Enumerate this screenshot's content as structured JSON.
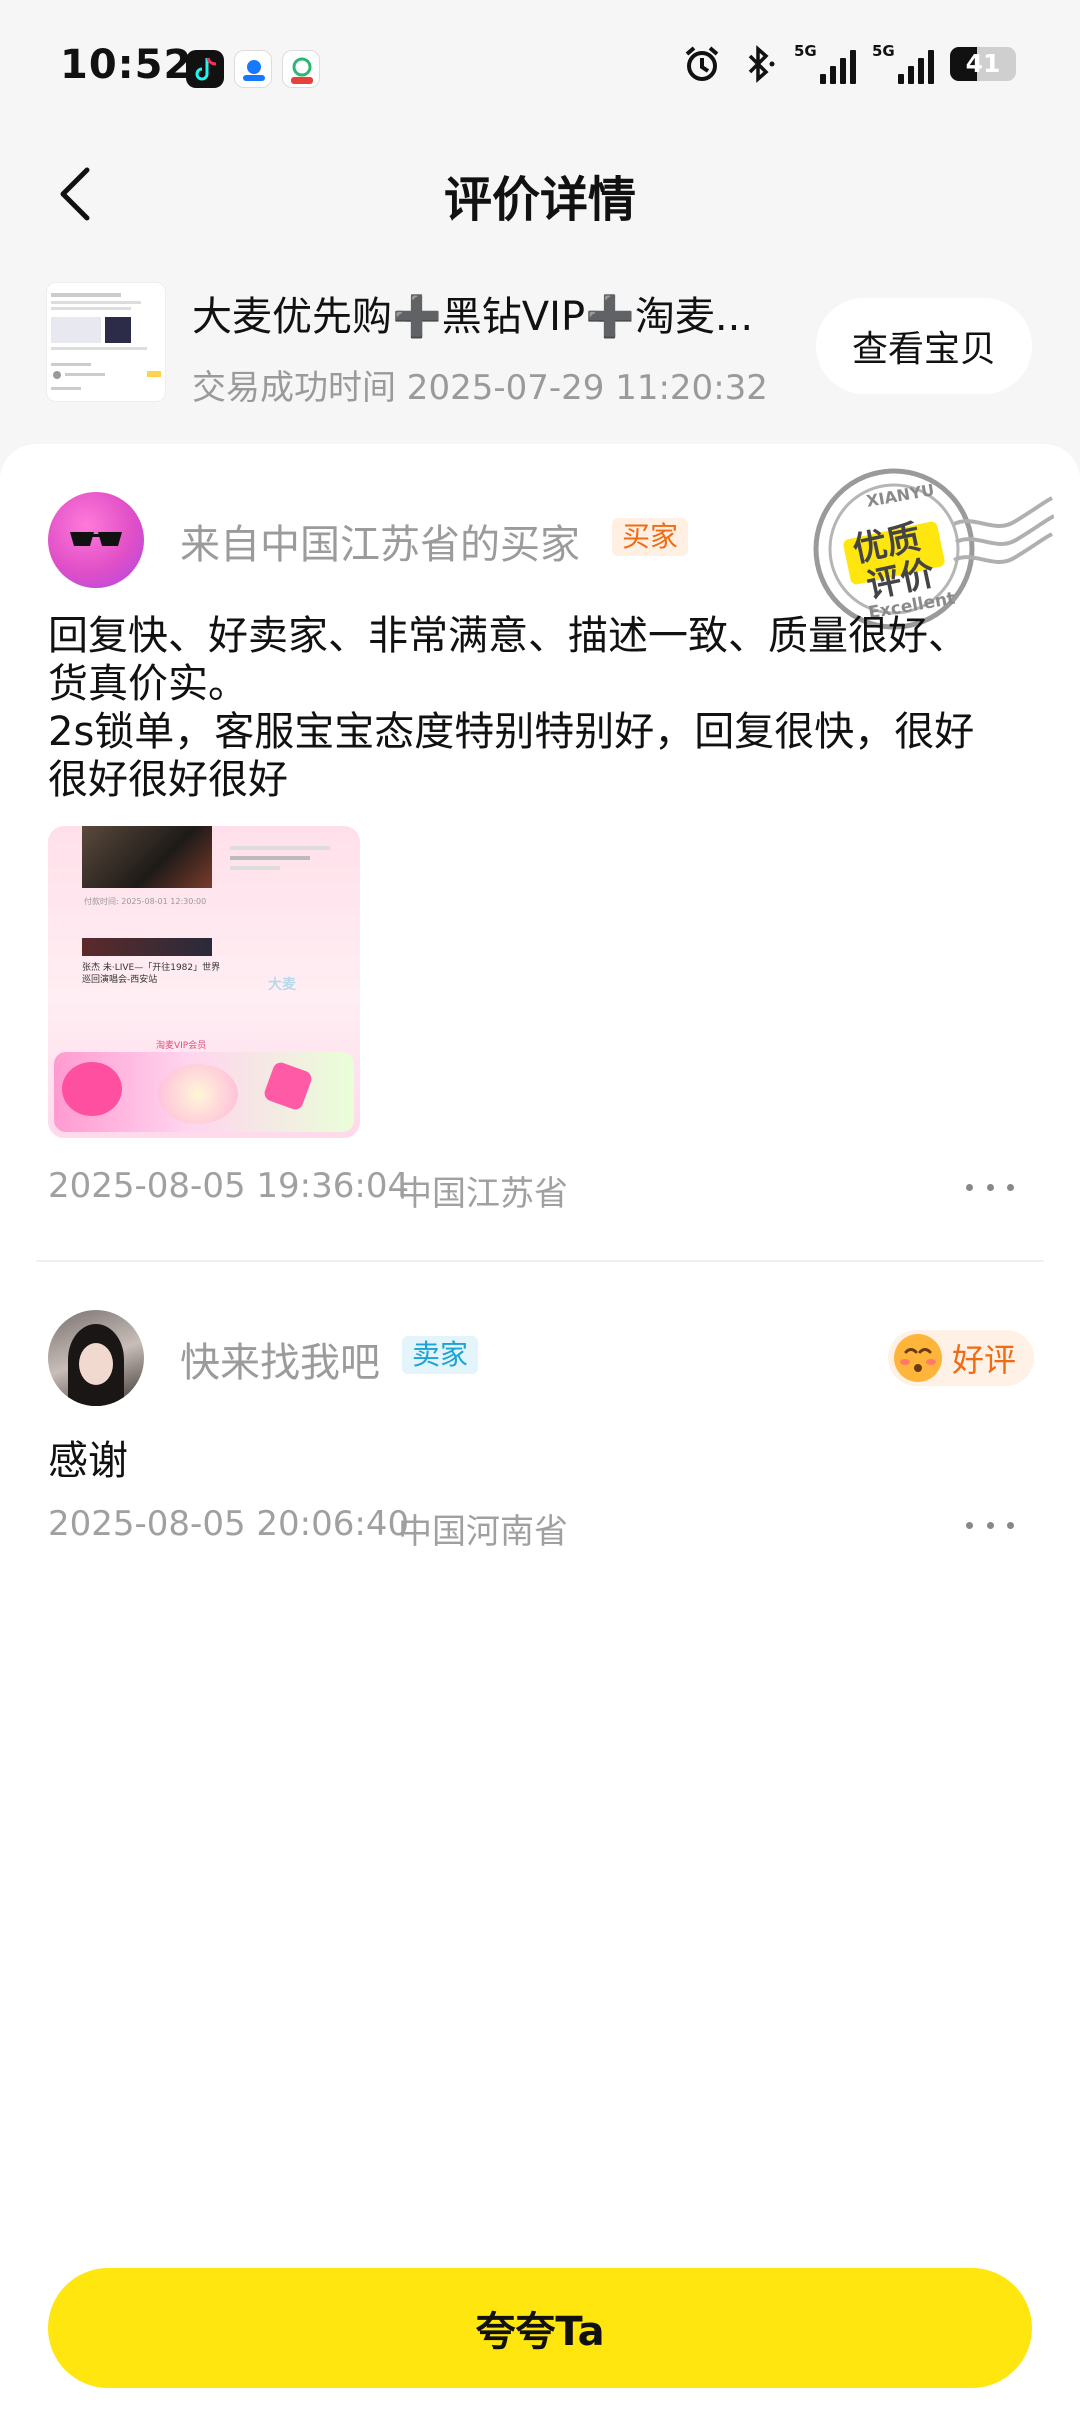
{
  "status_bar": {
    "time": "10:52",
    "network_1": "5G",
    "network_2": "5G",
    "battery": "41",
    "battery_level": 0.41
  },
  "nav": {
    "title": "评价详情"
  },
  "product": {
    "title": "大麦优先购➕黑钻VIP➕淘麦...",
    "time_label": "交易成功时间 2025-07-29 11:20:32",
    "view_button": "查看宝贝"
  },
  "buyer_review": {
    "name": "来自中国江苏省的买家",
    "role": "买家",
    "text": "回复快、好卖家、非常满意、描述一致、质量很好、\n货真价实。\n2s锁单，客服宝宝态度特别特别好，回复很快，很好\n很好很好很好",
    "image_texts": [
      "付款时间: 2025-08-01 12:30:00",
      "张杰 未·LIVE—「开往1982」世界巡回演唱会-西安站",
      "大麦",
      "淘麦VIP会员"
    ],
    "time": "2025-08-05 19:36:04",
    "location": "中国江苏省",
    "stamp": {
      "en_top": "XIANYU",
      "cn_line1": "优质",
      "cn_line2": "评价",
      "en_bottom": "Excellent"
    }
  },
  "seller_reply": {
    "name": "快来找我吧",
    "role": "卖家",
    "badge": "好评",
    "text": "感谢",
    "time": "2025-08-05 20:06:40",
    "location": "中国河南省"
  },
  "footer": {
    "praise_button": "夸夸Ta"
  },
  "colors": {
    "accent_yellow": "#ffe60f",
    "buyer_tag": "#f26a12",
    "seller_tag": "#1aa3d4"
  }
}
